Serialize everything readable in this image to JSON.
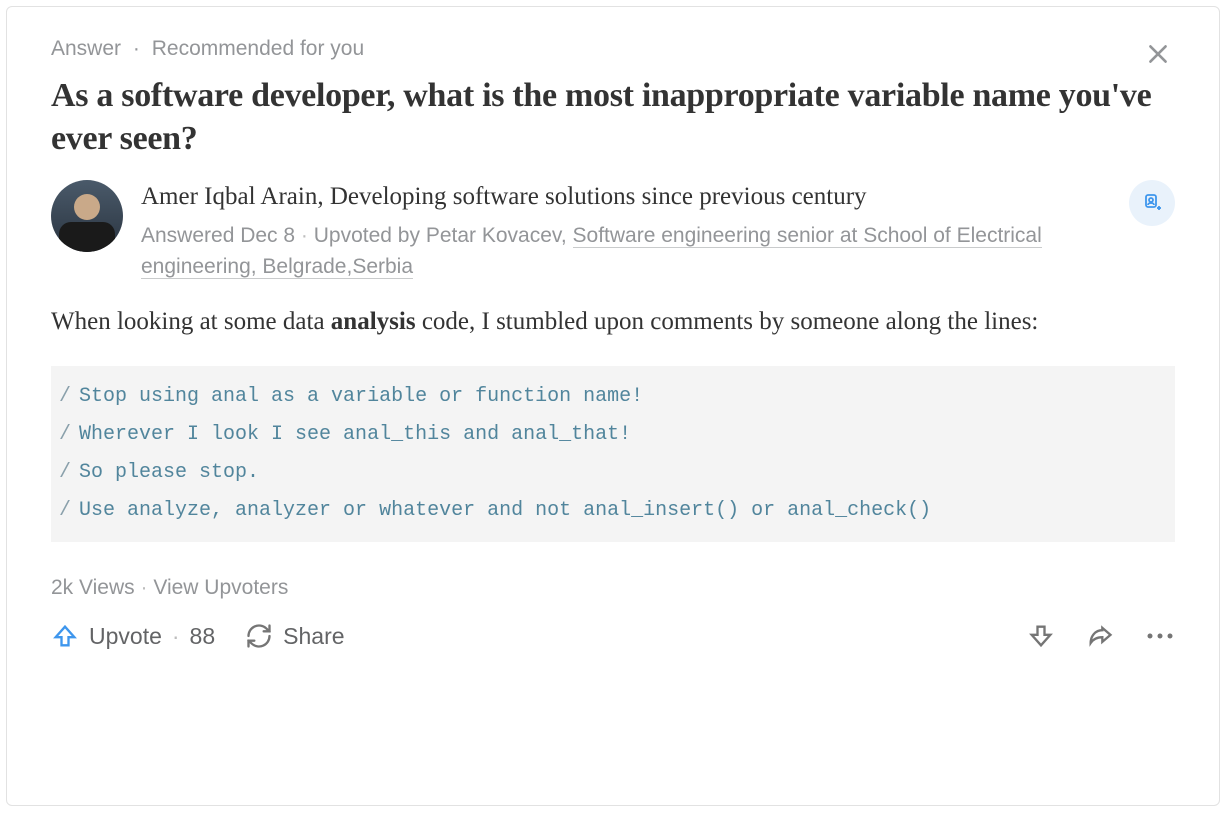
{
  "meta": {
    "category": "Answer",
    "reason": "Recommended for you"
  },
  "question": "As a software developer, what is the most inappropriate variable name you've ever seen?",
  "author": {
    "name": "Amer Iqbal Arain",
    "tagline": "Developing software solutions since previous century",
    "answered": "Answered Dec 8",
    "upvoted_by_prefix": "Upvoted by ",
    "upvoter_name": "Petar Kovacev",
    "upvoter_credential": "Software engineering senior at School of Electrical engineering, Belgrade,Serbia"
  },
  "body": {
    "pre": "When looking at some data ",
    "bold": "analysis",
    "post": " code, I stumbled upon comments by someone along the lines:"
  },
  "code": [
    "Stop using anal as a variable or function name!",
    "Wherever I look I see anal_this and anal_that!",
    "So please stop.",
    "Use analyze, analyzer or whatever and not anal_insert() or anal_check()"
  ],
  "stats": {
    "views": "2k Views",
    "view_upvoters": "View Upvoters"
  },
  "actions": {
    "upvote": "Upvote",
    "upvote_count": "88",
    "share": "Share"
  }
}
